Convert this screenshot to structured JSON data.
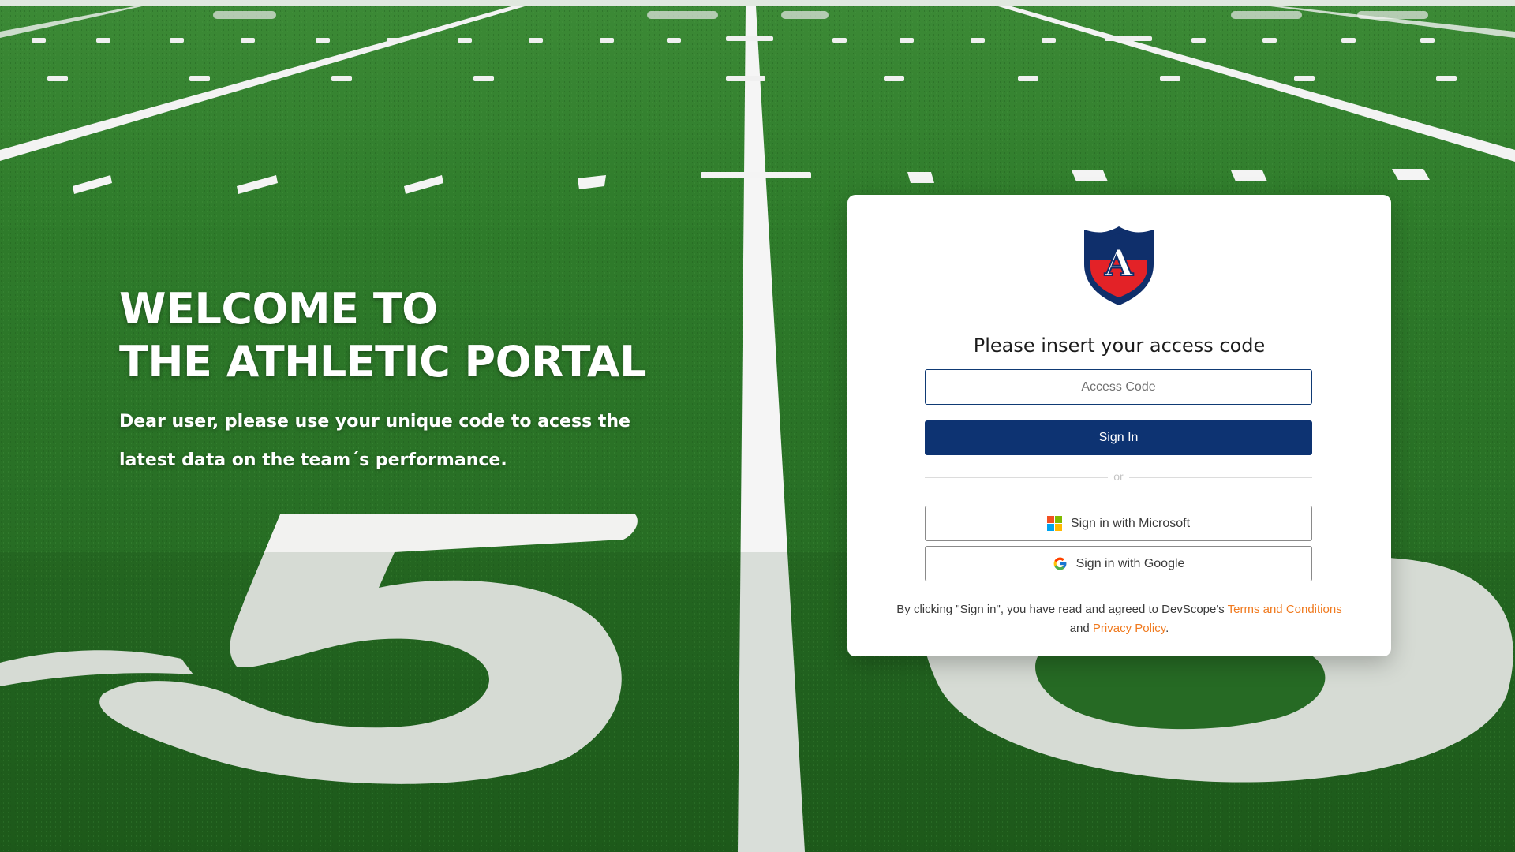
{
  "hero": {
    "title_line1": "WELCOME TO",
    "title_line2": "THE ATHLETIC PORTAL",
    "subtitle": "Dear user, please use your unique code to acess the latest data on the team´s performance."
  },
  "login_card": {
    "logo_letter": "A",
    "title": "Please insert your access code",
    "access_code_placeholder": "Access Code",
    "access_code_value": "",
    "signin_label": "Sign In",
    "divider_text": "or",
    "microsoft_label": "Sign in with Microsoft",
    "google_label": "Sign in with Google",
    "terms_prefix": "By clicking \"Sign in\", you have read and agreed to DevScope's ",
    "terms_link": "Terms and Conditions",
    "terms_middle": " and ",
    "privacy_link": "Privacy Policy",
    "terms_suffix": "."
  },
  "colors": {
    "primary_navy": "#0d3372",
    "link_orange": "#f07a1f",
    "logo_red": "#e32227",
    "logo_navy": "#0f2f6b",
    "field_green": "#2a7127"
  },
  "icons": {
    "microsoft": "microsoft-logo-icon",
    "google": "google-logo-icon",
    "brand": "athletic-shield-logo"
  }
}
